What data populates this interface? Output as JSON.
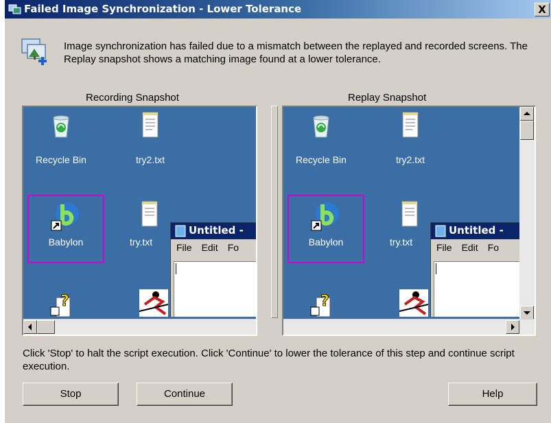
{
  "window": {
    "title": "Failed Image Synchronization - Lower Tolerance",
    "close_glyph": "X"
  },
  "message": "Image synchronization has failed due to a mismatch between the replayed and recorded screens.  The Replay snapshot shows a matching image found at a lower tolerance.",
  "panels": {
    "recording_label": "Recording Snapshot",
    "replay_label": "Replay Snapshot"
  },
  "desktop": {
    "icons": [
      {
        "label": "Recycle Bin",
        "icon": "recycle-bin-icon"
      },
      {
        "label": "try2.txt",
        "icon": "text-file-icon"
      },
      {
        "label": "Babylon",
        "icon": "babylon-icon"
      },
      {
        "label": "try.txt",
        "icon": "text-file-icon"
      }
    ],
    "notepad": {
      "title": "Untitled -",
      "menu": [
        "File",
        "Edit",
        "Fo"
      ]
    }
  },
  "footer": {
    "text": "Click 'Stop' to halt the script execution. Click 'Continue' to lower the tolerance of this step and continue script execution."
  },
  "buttons": {
    "stop": "Stop",
    "continue": "Continue",
    "help": "Help"
  },
  "colors": {
    "desktop_blue": "#3a6ea5",
    "selection_magenta": "#d000d0",
    "titlebar_dark": "#0a246a"
  }
}
